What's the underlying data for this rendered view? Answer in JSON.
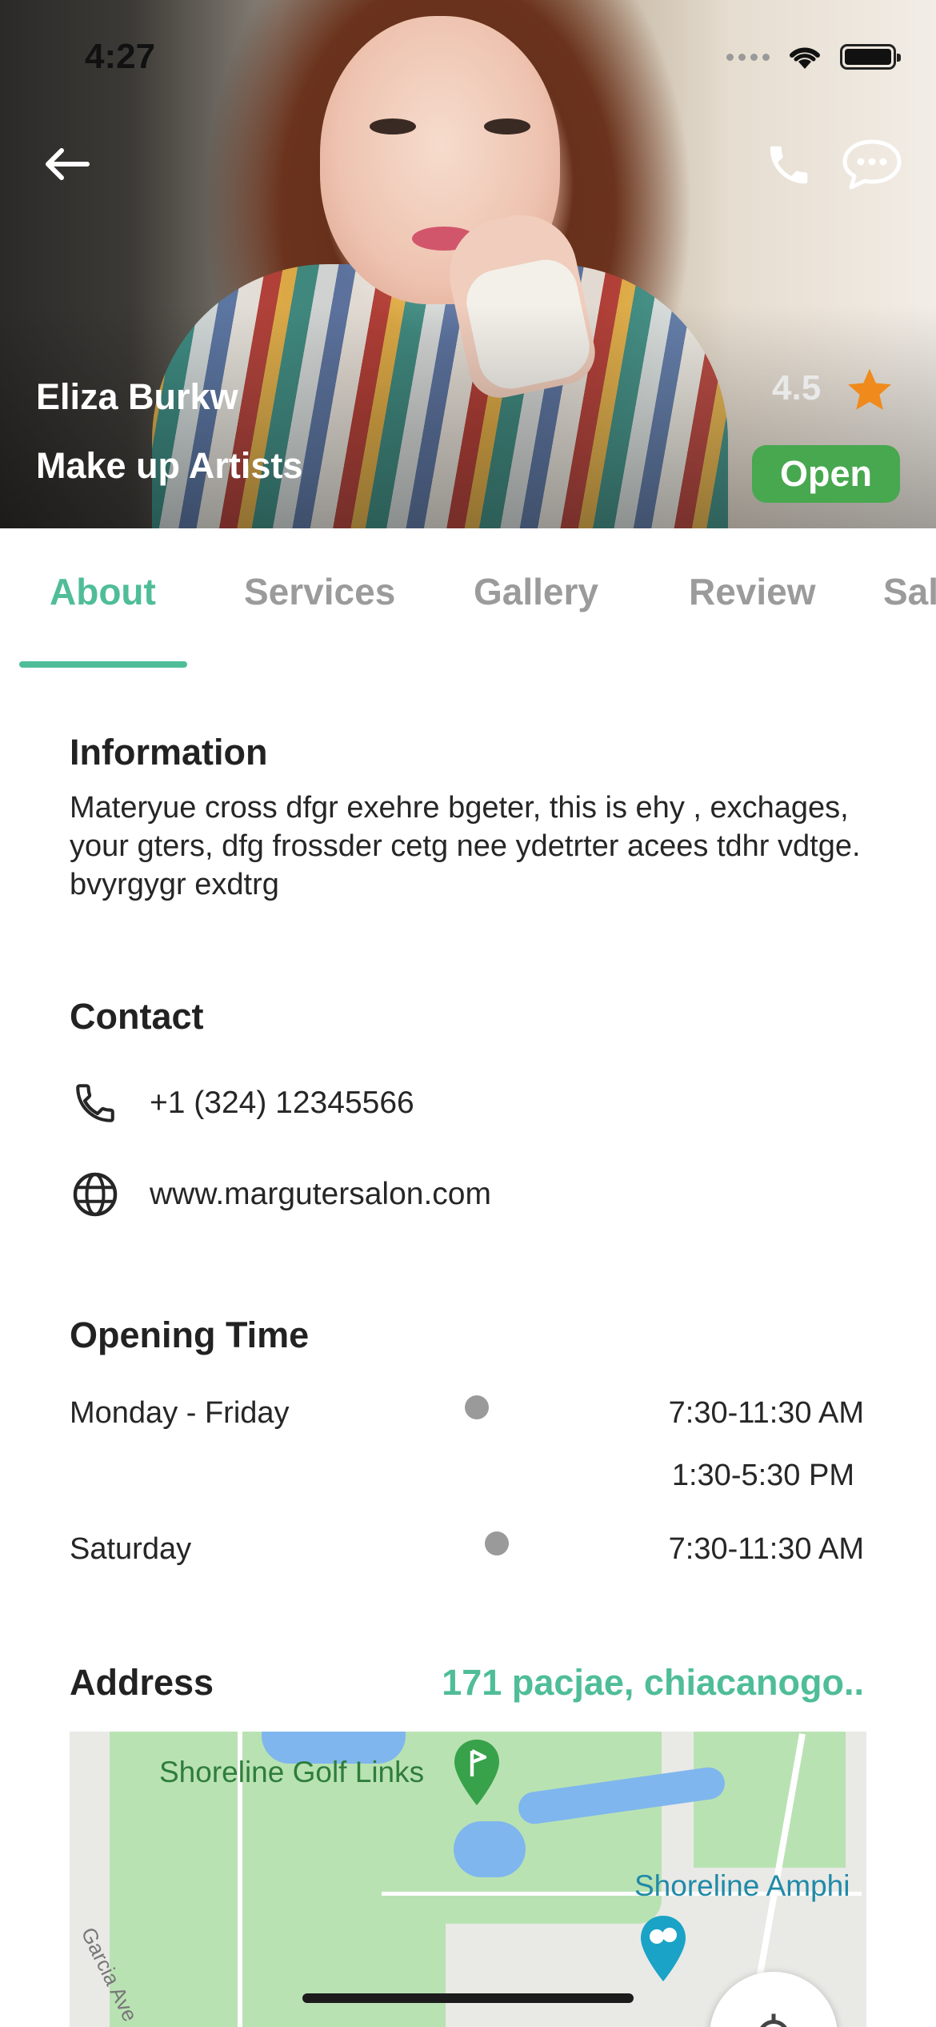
{
  "status_bar": {
    "time": "4:27"
  },
  "profile": {
    "name": "Eliza Burkw",
    "role": "Make up Artists",
    "rating": "4.5",
    "status": "Open"
  },
  "tabs": [
    {
      "label": "About",
      "active": true
    },
    {
      "label": "Services",
      "active": false
    },
    {
      "label": "Gallery",
      "active": false
    },
    {
      "label": "Review",
      "active": false
    },
    {
      "label": "Sal",
      "active": false
    }
  ],
  "information": {
    "title": "Information",
    "text": "Materyue cross dfgr exehre bgeter, this is ehy , exchages, your gters, dfg frossder cetg nee ydetrter acees tdhr vdtge. bvyrgygr exdtrg"
  },
  "contact": {
    "title": "Contact",
    "phone": "+1 (324) 12345566",
    "website": "www.margutersalon.com"
  },
  "opening_time": {
    "title": "Opening Time",
    "rows": [
      {
        "day": "Monday - Friday",
        "times": [
          "7:30-11:30 AM",
          "1:30-5:30 PM"
        ]
      },
      {
        "day": "Saturday",
        "times": [
          "7:30-11:30 AM"
        ]
      }
    ]
  },
  "address": {
    "title": "Address",
    "value": "171 pacjae, chiacanogo.."
  },
  "map": {
    "labels": [
      "Shoreline Golf Links",
      "Shoreline Amphi",
      "Garcia Ave"
    ]
  },
  "colors": {
    "accent": "#4fbd98",
    "open_badge": "#47a84f",
    "star": "#f08a1c"
  }
}
